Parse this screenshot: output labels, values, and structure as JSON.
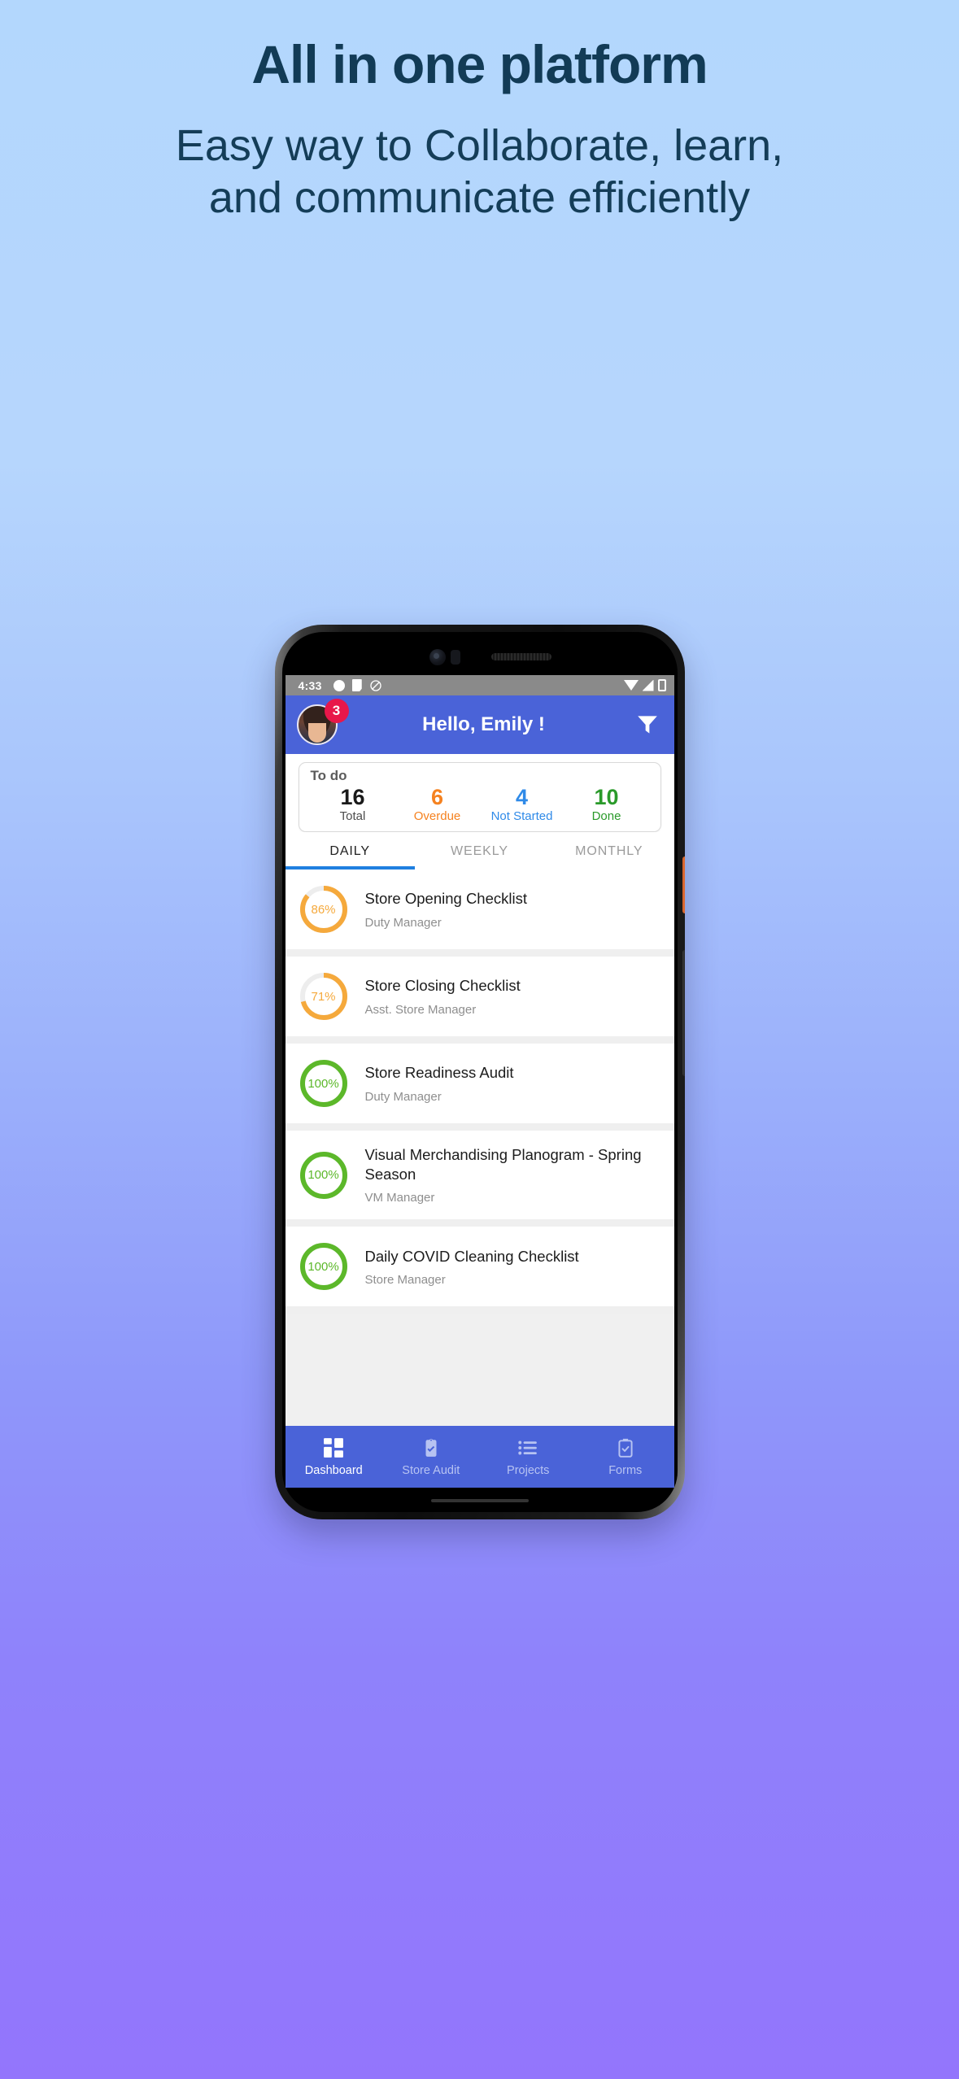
{
  "marketing": {
    "headline": "All in one platform",
    "subheadline": "Easy way to Collaborate, learn, and communicate efficiently"
  },
  "colors": {
    "brand_blue": "#4a63d8",
    "accent_orange": "#f58220",
    "accent_green": "#2a9a2a",
    "accent_blue": "#2f8ae8",
    "badge_red": "#e8174a",
    "heading_navy": "#123b56"
  },
  "phone": {
    "statusbar": {
      "time": "4:33",
      "icons": [
        "dot-icon",
        "note-icon",
        "silent-mode-icon"
      ],
      "right_icons": [
        "wifi-icon",
        "signal-icon",
        "battery-icon"
      ]
    },
    "appbar": {
      "title": "Hello, Emily !",
      "avatar_badge": "3",
      "filter_icon": "filter-icon"
    },
    "todo_card": {
      "label": "To do",
      "stats": [
        {
          "key": "total",
          "value": "16",
          "caption": "Total"
        },
        {
          "key": "overdue",
          "value": "6",
          "caption": "Overdue"
        },
        {
          "key": "notstarted",
          "value": "4",
          "caption": "Not Started"
        },
        {
          "key": "done",
          "value": "10",
          "caption": "Done"
        }
      ]
    },
    "tabs": [
      {
        "label": "DAILY",
        "active": true
      },
      {
        "label": "WEEKLY",
        "active": false
      },
      {
        "label": "MONTHLY",
        "active": false
      }
    ],
    "checklists": [
      {
        "percent": 86,
        "percent_label": "86%",
        "title": "Store Opening Checklist",
        "role": "Duty Manager",
        "color": "#f5a93c"
      },
      {
        "percent": 71,
        "percent_label": "71%",
        "title": "Store Closing Checklist",
        "role": "Asst. Store Manager",
        "color": "#f5a93c"
      },
      {
        "percent": 100,
        "percent_label": "100%",
        "title": "Store Readiness Audit",
        "role": "Duty Manager",
        "color": "#5cb82a"
      },
      {
        "percent": 100,
        "percent_label": "100%",
        "title": "Visual Merchandising Planogram - Spring Season",
        "role": "VM Manager",
        "color": "#5cb82a"
      },
      {
        "percent": 100,
        "percent_label": "100%",
        "title": "Daily COVID Cleaning Checklist",
        "role": "Store Manager",
        "color": "#5cb82a"
      }
    ],
    "bottom_nav": [
      {
        "label": "Dashboard",
        "icon": "dashboard-icon",
        "active": true
      },
      {
        "label": "Store Audit",
        "icon": "clipboard-check-icon",
        "active": false
      },
      {
        "label": "Projects",
        "icon": "list-icon",
        "active": false
      },
      {
        "label": "Forms",
        "icon": "forms-icon",
        "active": false
      }
    ]
  }
}
